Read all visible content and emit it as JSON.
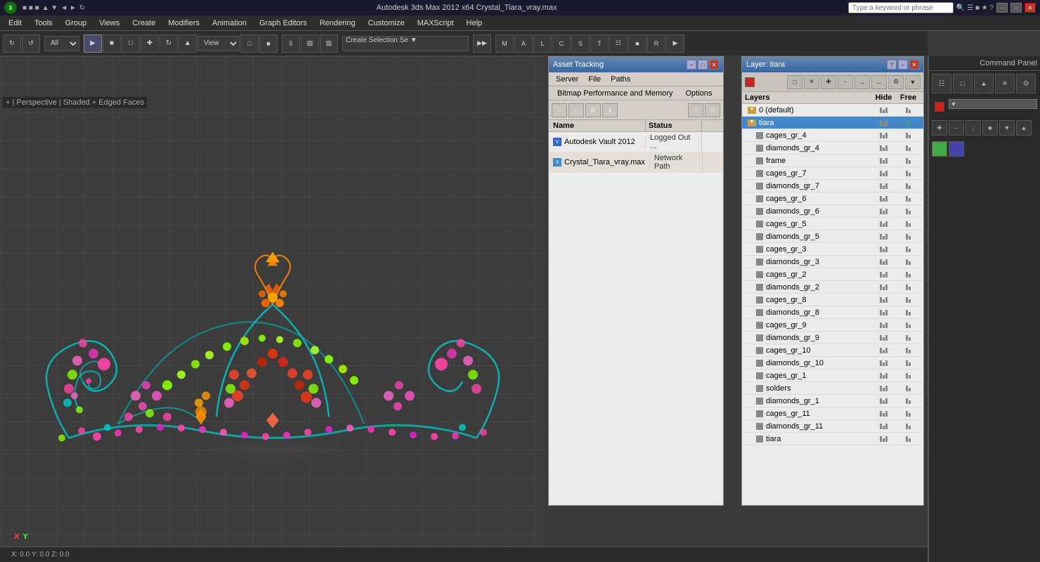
{
  "titlebar": {
    "title": "Autodesk 3ds Max 2012 x64    Crystal_Tiara_vray.max",
    "logo": "3",
    "search_placeholder": "Type a keyword or phrase"
  },
  "menubar": {
    "items": [
      "Edit",
      "Tools",
      "Group",
      "Views",
      "Create",
      "Modifiers",
      "Animation",
      "Graph Editors",
      "Rendering",
      "Customize",
      "MAXScript",
      "Help"
    ]
  },
  "viewport": {
    "label": "+ | Perspective | Shaded + Edged Faces"
  },
  "asset_panel": {
    "title": "Asset Tracking",
    "menus": [
      "Server",
      "File",
      "Paths"
    ],
    "submenus": [
      "Bitmap Performance and Memory",
      "Options"
    ],
    "columns": [
      "Name",
      "Status",
      ""
    ],
    "rows": [
      {
        "icon": "vault",
        "name": "Autodesk Vault 2012",
        "status": "Logged Out ...",
        "extra": ""
      },
      {
        "icon": "file",
        "name": "Crystal_Tiara_vray.max",
        "status": "Network Path",
        "extra": ""
      }
    ]
  },
  "layer_panel": {
    "title": "Layer: tiara",
    "col_headers": [
      "Layers",
      "Hide",
      "Free"
    ],
    "layers": [
      {
        "name": "0 (default)",
        "level": 0,
        "selected": false,
        "has_check": false
      },
      {
        "name": "tiara",
        "level": 0,
        "selected": true,
        "has_check": true
      },
      {
        "name": "cages_gr_4",
        "level": 1,
        "selected": false,
        "has_check": false
      },
      {
        "name": "diamonds_gr_4",
        "level": 1,
        "selected": false,
        "has_check": false
      },
      {
        "name": "frame",
        "level": 1,
        "selected": false,
        "has_check": false
      },
      {
        "name": "cages_gr_7",
        "level": 1,
        "selected": false,
        "has_check": false
      },
      {
        "name": "diamonds_gr_7",
        "level": 1,
        "selected": false,
        "has_check": false
      },
      {
        "name": "cages_gr_6",
        "level": 1,
        "selected": false,
        "has_check": false
      },
      {
        "name": "diamonds_gr_6",
        "level": 1,
        "selected": false,
        "has_check": false
      },
      {
        "name": "cages_gr_5",
        "level": 1,
        "selected": false,
        "has_check": false
      },
      {
        "name": "diamonds_gr_5",
        "level": 1,
        "selected": false,
        "has_check": false
      },
      {
        "name": "cages_gr_3",
        "level": 1,
        "selected": false,
        "has_check": false
      },
      {
        "name": "diamonds_gr_3",
        "level": 1,
        "selected": false,
        "has_check": false
      },
      {
        "name": "cages_gr_2",
        "level": 1,
        "selected": false,
        "has_check": false
      },
      {
        "name": "diamonds_gr_2",
        "level": 1,
        "selected": false,
        "has_check": false
      },
      {
        "name": "cages_gr_8",
        "level": 1,
        "selected": false,
        "has_check": false
      },
      {
        "name": "diamonds_gr_8",
        "level": 1,
        "selected": false,
        "has_check": false
      },
      {
        "name": "cages_gr_9",
        "level": 1,
        "selected": false,
        "has_check": false
      },
      {
        "name": "diamonds_gr_9",
        "level": 1,
        "selected": false,
        "has_check": false
      },
      {
        "name": "cages_gr_10",
        "level": 1,
        "selected": false,
        "has_check": false
      },
      {
        "name": "diamonds_gr_10",
        "level": 1,
        "selected": false,
        "has_check": false
      },
      {
        "name": "cages_gr_1",
        "level": 1,
        "selected": false,
        "has_check": false
      },
      {
        "name": "solders",
        "level": 1,
        "selected": false,
        "has_check": false
      },
      {
        "name": "diamonds_gr_1",
        "level": 1,
        "selected": false,
        "has_check": false
      },
      {
        "name": "cages_gr_11",
        "level": 1,
        "selected": false,
        "has_check": false
      },
      {
        "name": "diamonds_gr_11",
        "level": 1,
        "selected": false,
        "has_check": false
      },
      {
        "name": "tiara",
        "level": 1,
        "selected": false,
        "has_check": false
      }
    ]
  },
  "command_panel": {
    "label": "Command Panel"
  },
  "status": {
    "text": ""
  }
}
